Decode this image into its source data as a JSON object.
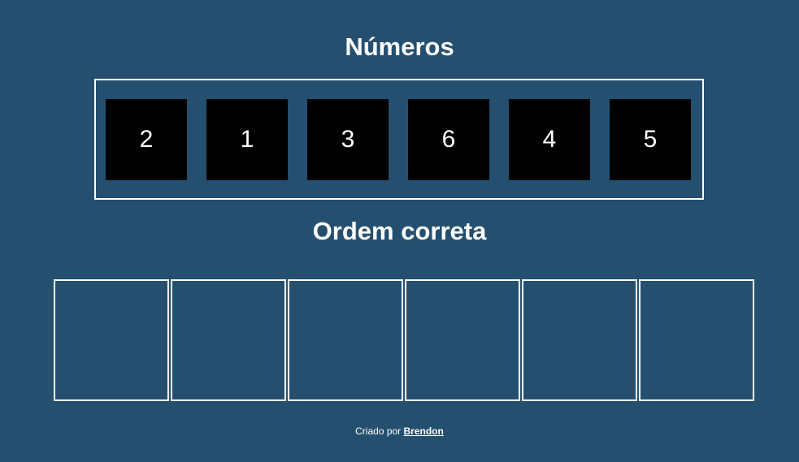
{
  "header": {
    "numbers_title": "Números",
    "order_title": "Ordem correta"
  },
  "tiles": [
    {
      "label": "2"
    },
    {
      "label": "1"
    },
    {
      "label": "3"
    },
    {
      "label": "6"
    },
    {
      "label": "4"
    },
    {
      "label": "5"
    }
  ],
  "slots_count": 6,
  "footer": {
    "prefix": "Criado por",
    "author": "Brendon"
  },
  "colors": {
    "background": "#254f6f",
    "tile": "#000000",
    "border": "#ffffff",
    "text": "#ffffff"
  }
}
